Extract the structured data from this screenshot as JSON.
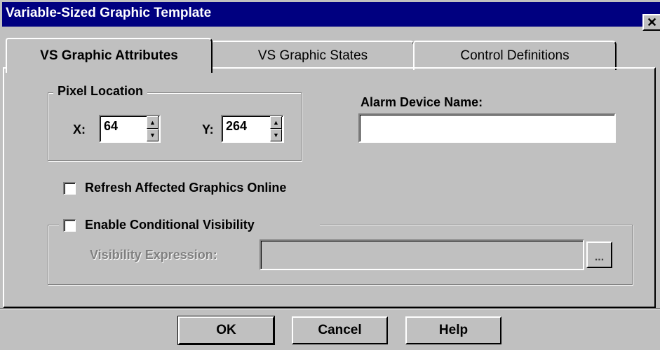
{
  "window": {
    "title": "Variable-Sized Graphic Template",
    "close_label": "✕",
    "close_icon": "close-icon"
  },
  "tabs": [
    {
      "label": "VS Graphic Attributes",
      "active": true
    },
    {
      "label": "VS Graphic States",
      "active": false
    },
    {
      "label": "Control Definitions",
      "active": false
    }
  ],
  "pixel_location": {
    "legend": "Pixel Location",
    "x_label": "X:",
    "x_value": "64",
    "y_label": "Y:",
    "y_value": "264",
    "spin_up_icon": "spin-up-icon",
    "spin_down_icon": "spin-down-icon"
  },
  "alarm": {
    "label": "Alarm Device Name:",
    "value": ""
  },
  "refresh_checkbox": {
    "label": "Refresh Affected Graphics Online",
    "checked": false
  },
  "visibility": {
    "checkbox_label": "Enable Conditional Visibility",
    "checked": false,
    "expression_label": "Visibility Expression:",
    "expression_value": "",
    "browse_label": "..."
  },
  "buttons": {
    "ok": "OK",
    "cancel": "Cancel",
    "help": "Help"
  },
  "colors": {
    "titlebar": "#000080",
    "face": "#c0c0c0",
    "disabled_text": "#808080"
  }
}
